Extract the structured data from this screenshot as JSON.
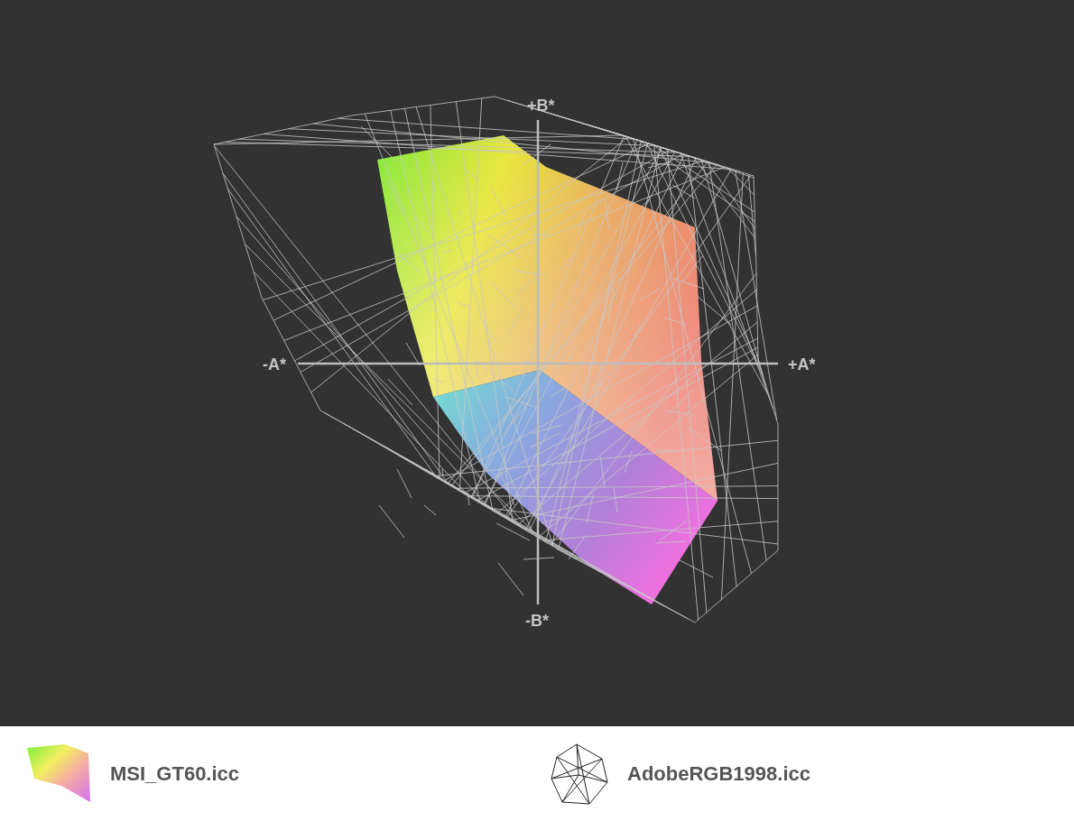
{
  "plot": {
    "axis_labels": {
      "top": "+B*",
      "bottom": "-B*",
      "left": "-A*",
      "right": "+A*"
    }
  },
  "legend": [
    {
      "label": "MSI_GT60.icc",
      "kind": "solid"
    },
    {
      "label": "AdobeRGB1998.icc",
      "kind": "wireframe"
    }
  ]
}
